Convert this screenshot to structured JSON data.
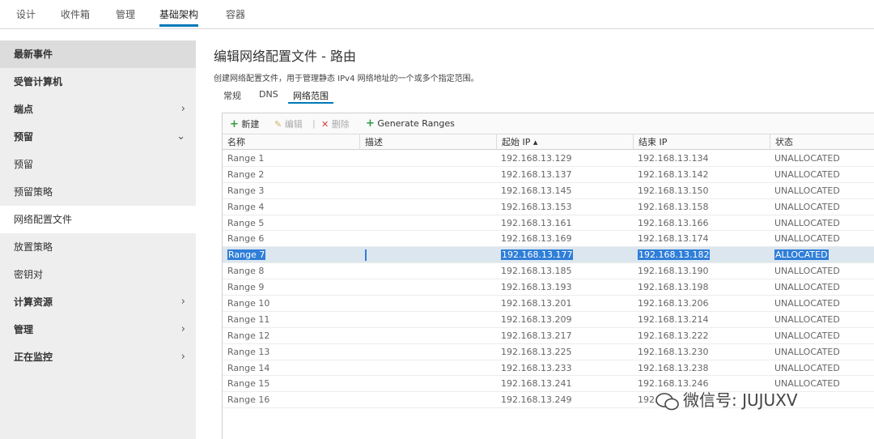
{
  "topnav": {
    "tabs": [
      {
        "label": "设计"
      },
      {
        "label": "收件箱"
      },
      {
        "label": "管理"
      },
      {
        "label": "基础架构"
      },
      {
        "label": "容器"
      }
    ]
  },
  "sidebar": {
    "items": [
      {
        "label": "最新事件"
      },
      {
        "label": "受管计算机"
      },
      {
        "label": "端点",
        "chevron": "›"
      },
      {
        "label": "预留",
        "chevron": "⌄"
      },
      {
        "label": "预留"
      },
      {
        "label": "预留策略"
      },
      {
        "label": "网络配置文件"
      },
      {
        "label": "放置策略"
      },
      {
        "label": "密钥对"
      },
      {
        "label": "计算资源",
        "chevron": "›"
      },
      {
        "label": "管理",
        "chevron": "›"
      },
      {
        "label": "正在监控",
        "chevron": "›"
      }
    ]
  },
  "main": {
    "title": "编辑网络配置文件 - 路由",
    "description": "创建网络配置文件，用于管理静态 IPv4 网络地址的一个或多个指定范围。",
    "subtabs": [
      {
        "label": "常规"
      },
      {
        "label": "DNS"
      },
      {
        "label": "网络范围"
      }
    ],
    "toolbar": {
      "new_label": "新建",
      "edit_label": "编辑",
      "delete_label": "删除",
      "separator": "|",
      "generate_label": "Generate Ranges"
    },
    "columns": [
      "名称",
      "描述",
      "起始 IP ▴",
      "结束 IP",
      "状态"
    ],
    "rows": [
      {
        "name": "Range 1",
        "desc": "",
        "start": "192.168.13.129",
        "end": "192.168.13.134",
        "status": "UNALLOCATED"
      },
      {
        "name": "Range 2",
        "desc": "",
        "start": "192.168.13.137",
        "end": "192.168.13.142",
        "status": "UNALLOCATED"
      },
      {
        "name": "Range 3",
        "desc": "",
        "start": "192.168.13.145",
        "end": "192.168.13.150",
        "status": "UNALLOCATED"
      },
      {
        "name": "Range 4",
        "desc": "",
        "start": "192.168.13.153",
        "end": "192.168.13.158",
        "status": "UNALLOCATED"
      },
      {
        "name": "Range 5",
        "desc": "",
        "start": "192.168.13.161",
        "end": "192.168.13.166",
        "status": "UNALLOCATED"
      },
      {
        "name": "Range 6",
        "desc": "",
        "start": "192.168.13.169",
        "end": "192.168.13.174",
        "status": "UNALLOCATED"
      },
      {
        "name": "Range 7",
        "desc": "",
        "start": "192.168.13.177",
        "end": "192.168.13.182",
        "status": "ALLOCATED"
      },
      {
        "name": "Range 8",
        "desc": "",
        "start": "192.168.13.185",
        "end": "192.168.13.190",
        "status": "UNALLOCATED"
      },
      {
        "name": "Range 9",
        "desc": "",
        "start": "192.168.13.193",
        "end": "192.168.13.198",
        "status": "UNALLOCATED"
      },
      {
        "name": "Range 10",
        "desc": "",
        "start": "192.168.13.201",
        "end": "192.168.13.206",
        "status": "UNALLOCATED"
      },
      {
        "name": "Range 11",
        "desc": "",
        "start": "192.168.13.209",
        "end": "192.168.13.214",
        "status": "UNALLOCATED"
      },
      {
        "name": "Range 12",
        "desc": "",
        "start": "192.168.13.217",
        "end": "192.168.13.222",
        "status": "UNALLOCATED"
      },
      {
        "name": "Range 13",
        "desc": "",
        "start": "192.168.13.225",
        "end": "192.168.13.230",
        "status": "UNALLOCATED"
      },
      {
        "name": "Range 14",
        "desc": "",
        "start": "192.168.13.233",
        "end": "192.168.13.238",
        "status": "UNALLOCATED"
      },
      {
        "name": "Range 15",
        "desc": "",
        "start": "192.168.13.241",
        "end": "192.168.13.246",
        "status": "UNALLOCATED"
      },
      {
        "name": "Range 16",
        "desc": "",
        "start": "192.168.13.249",
        "end": "192.",
        "status": ""
      }
    ]
  },
  "watermark": {
    "text": "微信号: JUJUXV"
  },
  "colors": {
    "accent": "#0079b8",
    "selection": "#2f7ed8",
    "add_green": "#2c9b3f",
    "delete_red": "#d43b3b"
  }
}
